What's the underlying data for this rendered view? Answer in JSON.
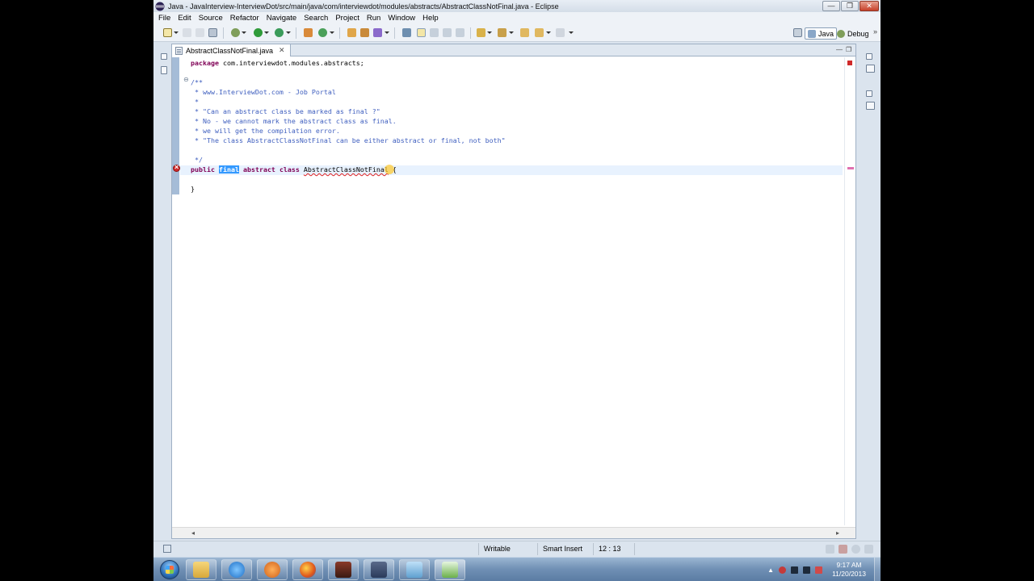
{
  "window": {
    "title": "Java - JavaInterview-InterviewDot/src/main/java/com/interviewdot/modules/abstracts/AbstractClassNotFinal.java - Eclipse",
    "minimize": "—",
    "restore": "❐",
    "close": "✕"
  },
  "menu": [
    "File",
    "Edit",
    "Source",
    "Refactor",
    "Navigate",
    "Search",
    "Project",
    "Run",
    "Window",
    "Help"
  ],
  "perspectives": {
    "java": "Java",
    "debug": "Debug"
  },
  "editor": {
    "tab_label": "AbstractClassNotFinal.java",
    "tab_close": "✕",
    "lines": {
      "l1_kw": "package",
      "l1_rest": " com.interviewdot.modules.abstracts;",
      "l4": "/**",
      "l5": " * www.InterviewDot.com - Job Portal",
      "l6": " *",
      "l7": " * \"Can an abstract class be marked as final ?\"",
      "l8": " * No - we cannot mark the abstract class as final.",
      "l9": " * we will get the compilation error.",
      "l10": " * \"The class AbstractClassNotFinal can be either abstract or final, not both\"",
      "l12": " */",
      "l13_public": "public",
      "l13_final": "final",
      "l13_abstract": "abstract",
      "l13_class": "class",
      "l13_name": "AbstractClassNotFinal",
      "l13_brace": " {",
      "l15": "}"
    }
  },
  "status": {
    "writable": "Writable",
    "insert_mode": "Smart Insert",
    "position": "12 : 13"
  },
  "clock": {
    "time": "9:17 AM",
    "date": "11/20/2013"
  },
  "colors": {
    "keyword": "#7f0055",
    "comment": "#3f5fbf",
    "selection": "#3399ff",
    "error": "#d02a2a"
  }
}
